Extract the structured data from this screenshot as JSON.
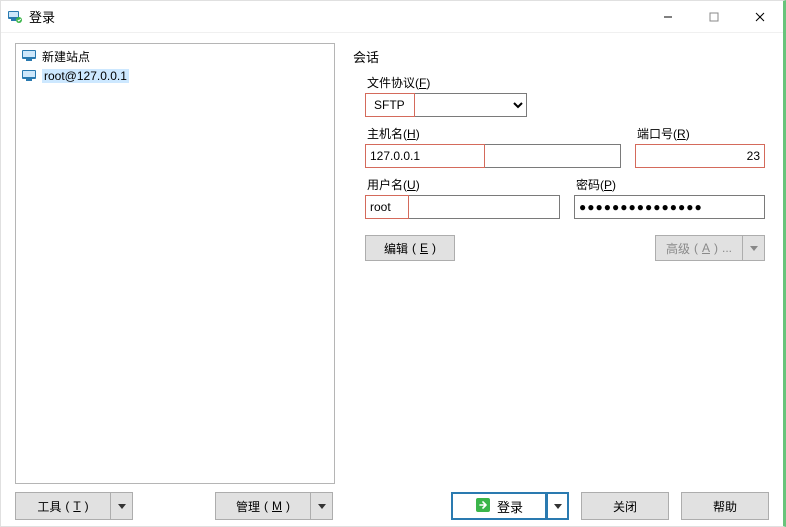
{
  "window": {
    "title": "登录"
  },
  "sidebar": {
    "items": [
      {
        "label": "新建站点",
        "selected": false,
        "icon_color": "#2a7ab0"
      },
      {
        "label": "root@127.0.0.1",
        "selected": true,
        "icon_color": "#2a7ab0"
      }
    ]
  },
  "session": {
    "group_label": "会话",
    "protocol_label": "文件协议",
    "protocol_hotkey": "F",
    "protocol_value": "SFTP",
    "host_label": "主机名",
    "host_hotkey": "H",
    "host_value": "127.0.0.1",
    "port_label": "端口号",
    "port_hotkey": "R",
    "port_value": "23",
    "user_label": "用户名",
    "user_hotkey": "U",
    "user_value": "root",
    "password_label": "密码",
    "password_hotkey": "P",
    "password_masked": "●●●●●●●●●●●●●●●",
    "edit_label": "编辑",
    "edit_hotkey": "E",
    "advanced_label": "高级",
    "advanced_hotkey": "A",
    "advanced_suffix": "..."
  },
  "footer": {
    "tools_label": "工具",
    "tools_hotkey": "T",
    "manage_label": "管理",
    "manage_hotkey": "M",
    "login_label": "登录",
    "close_label": "关闭",
    "help_label": "帮助"
  },
  "highlight_color": "#d46a5b"
}
